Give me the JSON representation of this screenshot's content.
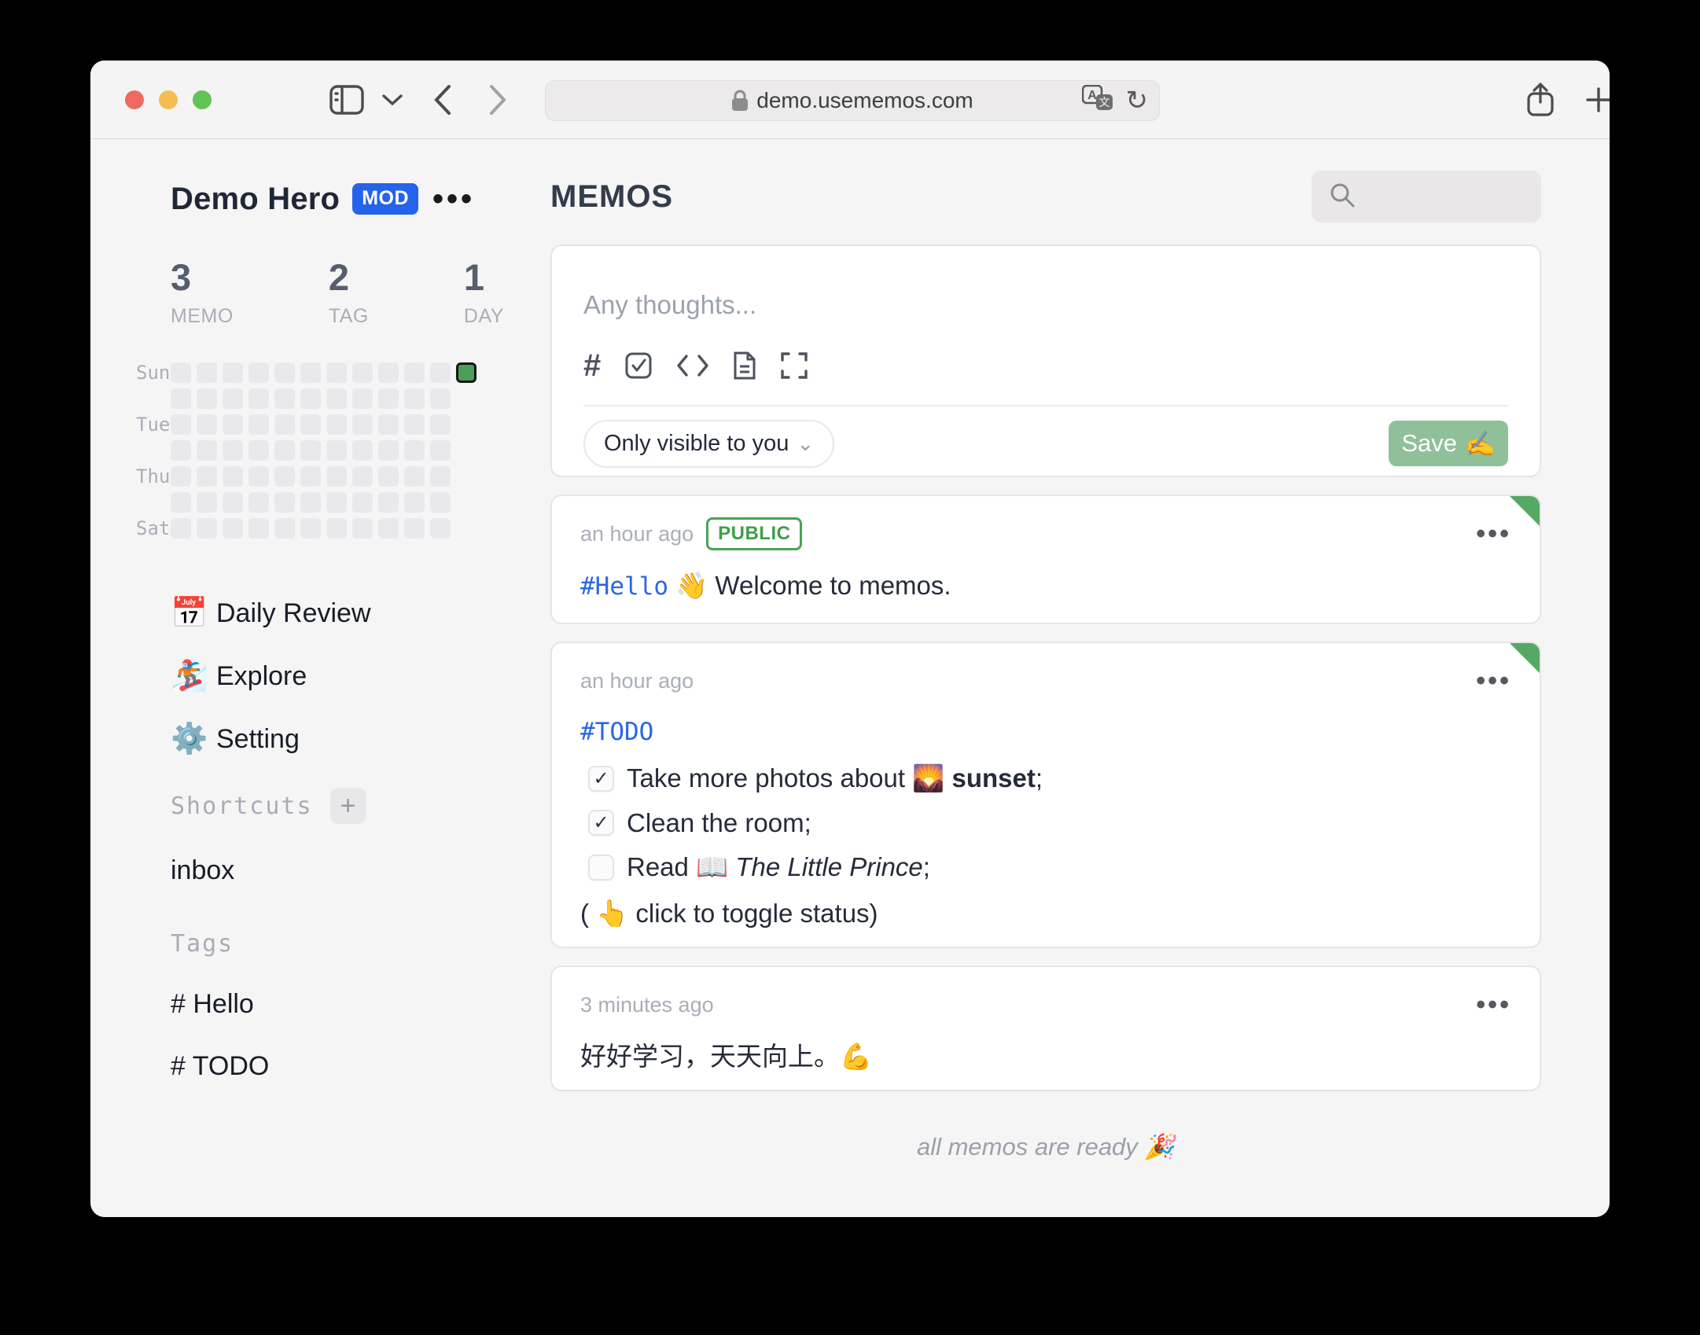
{
  "browser": {
    "url": "demo.usememos.com",
    "reload_glyph": "↻"
  },
  "sidebar": {
    "user": {
      "name": "Demo Hero",
      "badge": "MOD",
      "menu": "•••"
    },
    "stats": [
      {
        "value": "3",
        "label": "MEMO"
      },
      {
        "value": "2",
        "label": "TAG"
      },
      {
        "value": "1",
        "label": "DAY"
      }
    ],
    "heatmap": {
      "rows": 7,
      "columns": 12,
      "day_labels": [
        "Sun",
        "Tue",
        "Thu",
        "Sat"
      ],
      "active_cell": {
        "row": 0,
        "col": 11
      },
      "cell_color": "#e9e9ed",
      "active_color": "#4a9e58"
    },
    "nav": [
      {
        "icon": "📅",
        "label": "Daily Review"
      },
      {
        "icon": "🏂",
        "label": "Explore"
      },
      {
        "icon": "⚙️",
        "label": "Setting"
      }
    ],
    "shortcuts": {
      "heading": "Shortcuts",
      "add_label": "+",
      "items": [
        "inbox"
      ]
    },
    "tags": {
      "heading": "Tags",
      "items": [
        "# Hello",
        "# TODO"
      ]
    }
  },
  "main": {
    "title": "MEMOS",
    "editor": {
      "placeholder": "Any thoughts...",
      "visibility": "Only visible to you",
      "visibility_chevron": "⌄",
      "save_label": "Save",
      "save_emoji": "✍️"
    },
    "memos": [
      {
        "time": "an hour ago",
        "badge": "PUBLIC",
        "menu": "•••",
        "tag": "#Hello",
        "text": " 👋 Welcome to memos."
      },
      {
        "time": "an hour ago",
        "menu": "•••",
        "tag": "#TODO",
        "todos": [
          {
            "mark": "✓",
            "prefix": "Take more photos about 🌄 ",
            "emphasis": "sunset",
            "suffix": ";"
          },
          {
            "mark": "✓",
            "prefix": "Clean the room",
            "emphasis": "",
            "suffix": ";"
          },
          {
            "mark": "",
            "prefix": "Read 📖 ",
            "emphasis": "The Little Prince",
            "suffix": ";"
          }
        ],
        "hint": "( 👆  click to toggle status)"
      },
      {
        "time": "3 minutes ago",
        "menu": "•••",
        "text": "好好学习，天天向上。💪"
      }
    ],
    "footer": "all memos are ready 🎉"
  }
}
